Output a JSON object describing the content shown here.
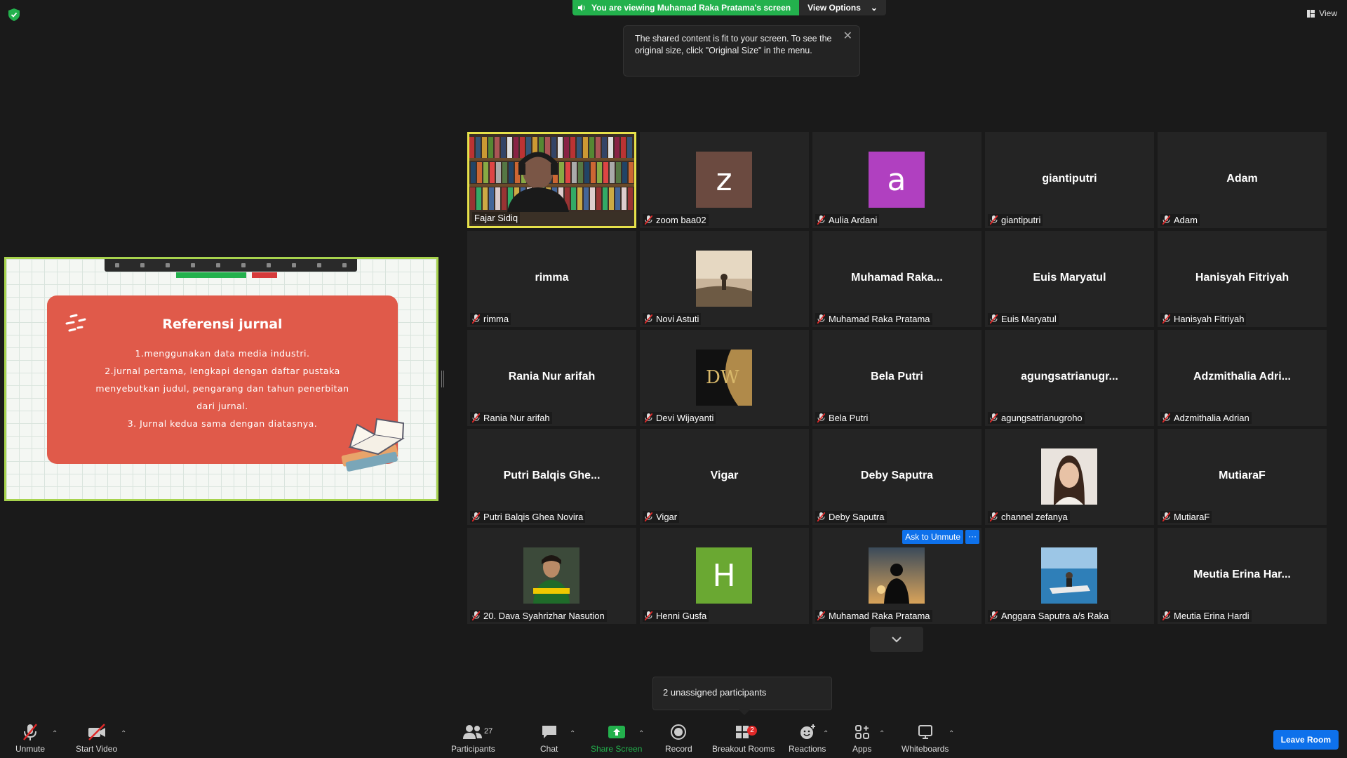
{
  "header": {
    "banner_text": "You are viewing Muhamad Raka Pratama's screen",
    "view_options_label": "View Options",
    "view_label": "View"
  },
  "tooltip": {
    "text": "The shared content is fit to your screen. To see the original size, click \"Original Size\" in the menu."
  },
  "shared_screen": {
    "slide_title": "Referensi jurnal",
    "lines": [
      "1.menggunakan data media industri.",
      "2.jurnal pertama, lengkapi dengan daftar pustaka",
      "menyebutkan judul, pengarang dan tahun penerbitan",
      "dari jurnal.",
      "3. Jurnal kedua sama dengan diatasnya."
    ]
  },
  "gallery": {
    "tiles": [
      {
        "name": "Fajar Sidiq",
        "kind": "photo-video",
        "active": true,
        "muted": false
      },
      {
        "name": "zoom baa02",
        "kind": "letter",
        "letter": "z",
        "color": "#6b4a40",
        "muted": true
      },
      {
        "name": "Aulia Ardani",
        "kind": "letter",
        "letter": "a",
        "color": "#b040c0",
        "muted": true
      },
      {
        "name": "giantiputri",
        "kind": "text",
        "display": "giantiputri",
        "muted": true
      },
      {
        "name": "Adam",
        "kind": "text",
        "display": "Adam",
        "muted": true
      },
      {
        "name": "rimma",
        "kind": "text",
        "display": "rimma",
        "muted": true
      },
      {
        "name": "Novi Astuti",
        "kind": "photo",
        "photo": "sunset-sea",
        "muted": true
      },
      {
        "name": "Muhamad Raka Pratama",
        "kind": "text",
        "display": "Muhamad  Raka...",
        "muted": true
      },
      {
        "name": "Euis Maryatul",
        "kind": "text",
        "display": "Euis Maryatul",
        "muted": true
      },
      {
        "name": "Hanisyah Fitriyah",
        "kind": "text",
        "display": "Hanisyah Fitriyah",
        "muted": true
      },
      {
        "name": "Rania Nur arifah",
        "kind": "text",
        "display": "Rania Nur arifah",
        "muted": true
      },
      {
        "name": "Devi Wijayanti",
        "kind": "photo",
        "photo": "dw-logo",
        "muted": true
      },
      {
        "name": "Bela Putri",
        "kind": "text",
        "display": "Bela Putri",
        "muted": true
      },
      {
        "name": "agungsatrianugroho",
        "kind": "text",
        "display": "agungsatrianugr...",
        "muted": true
      },
      {
        "name": "Adzmithalia Adrian",
        "kind": "text",
        "display": "Adzmithalia  Adri...",
        "muted": true
      },
      {
        "name": "Putri Balqis Ghea Novira",
        "kind": "text",
        "display": "Putri Balqis Ghe...",
        "muted": true
      },
      {
        "name": "Vigar",
        "kind": "text",
        "display": "Vigar",
        "muted": true
      },
      {
        "name": "Deby Saputra",
        "kind": "text",
        "display": "Deby Saputra",
        "muted": true
      },
      {
        "name": "channel zefanya",
        "kind": "photo",
        "photo": "portrait-girl",
        "muted": true
      },
      {
        "name": "MutiaraF",
        "kind": "text",
        "display": "MutiaraF",
        "muted": true
      },
      {
        "name": "20. Dava Syahrizhar Nasution",
        "kind": "photo",
        "photo": "portrait-boy",
        "muted": true
      },
      {
        "name": "Henni Gusfa",
        "kind": "letter",
        "letter": "H",
        "color": "#6aa832",
        "muted": true
      },
      {
        "name": "Muhamad Raka Pratama",
        "kind": "photo",
        "photo": "silhouette-sunset",
        "muted": true,
        "hover": true
      },
      {
        "name": "Anggara Saputra a/s Raka",
        "kind": "photo",
        "photo": "jetski",
        "muted": true
      },
      {
        "name": "Meutia Erina Hardi",
        "kind": "text",
        "display": "Meutia  Erina  Har...",
        "muted": true
      }
    ],
    "ask_unmute_label": "Ask to Unmute",
    "more_label": "···"
  },
  "unassigned": {
    "text": "2 unassigned participants"
  },
  "toolbar": {
    "unmute": "Unmute",
    "start_video": "Start Video",
    "participants": "Participants",
    "participants_count": "27",
    "chat": "Chat",
    "share_screen": "Share Screen",
    "record": "Record",
    "breakout_rooms": "Breakout Rooms",
    "breakout_badge": "2",
    "reactions": "Reactions",
    "apps": "Apps",
    "whiteboards": "Whiteboards",
    "leave_room": "Leave Room"
  },
  "colors": {
    "accent_green": "#23b14d",
    "accent_blue": "#0e71eb",
    "active_speaker": "#e6e14a",
    "mute_red": "#e02828"
  }
}
